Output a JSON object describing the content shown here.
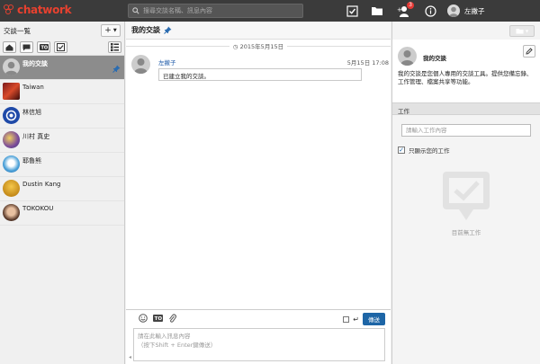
{
  "app": {
    "logo_text": "chatwork",
    "brand_color": "#e8412f"
  },
  "search": {
    "placeholder": "搜尋交談名稱、訊息內容"
  },
  "header": {
    "user_name": "左撇子",
    "contacts_badge": "3"
  },
  "sidebar": {
    "title": "交談一覧",
    "add_label": "+",
    "rooms": [
      {
        "name": "我的交談",
        "active": true
      },
      {
        "name": "Taiwan"
      },
      {
        "name": "林信旭"
      },
      {
        "name": "川村 真史"
      },
      {
        "name": "耶魯熊"
      },
      {
        "name": "Dustin Kang"
      },
      {
        "name": "TOKOKOU"
      }
    ]
  },
  "chat": {
    "title": "我的交談",
    "date": "2015年5月15日",
    "messages": [
      {
        "sender": "左撇子",
        "time": "5月15日 17:08",
        "text": "已建立我的交談。"
      }
    ],
    "send_label": "傳送",
    "compose_placeholder_line1": "請在此輸入訊息內容",
    "compose_placeholder_line2": "（按下Shift + Enter鍵傳送）"
  },
  "info": {
    "name": "我的交談",
    "description": "我的交談是您個人專用的交談工具。提供您備忘錄、工作管理、檔案共享等功能。"
  },
  "tasks": {
    "header": "工作",
    "input_placeholder": "請輸入工作內容",
    "show_mine_label": "只顯示您的工作",
    "empty_label": "目前無工作"
  }
}
